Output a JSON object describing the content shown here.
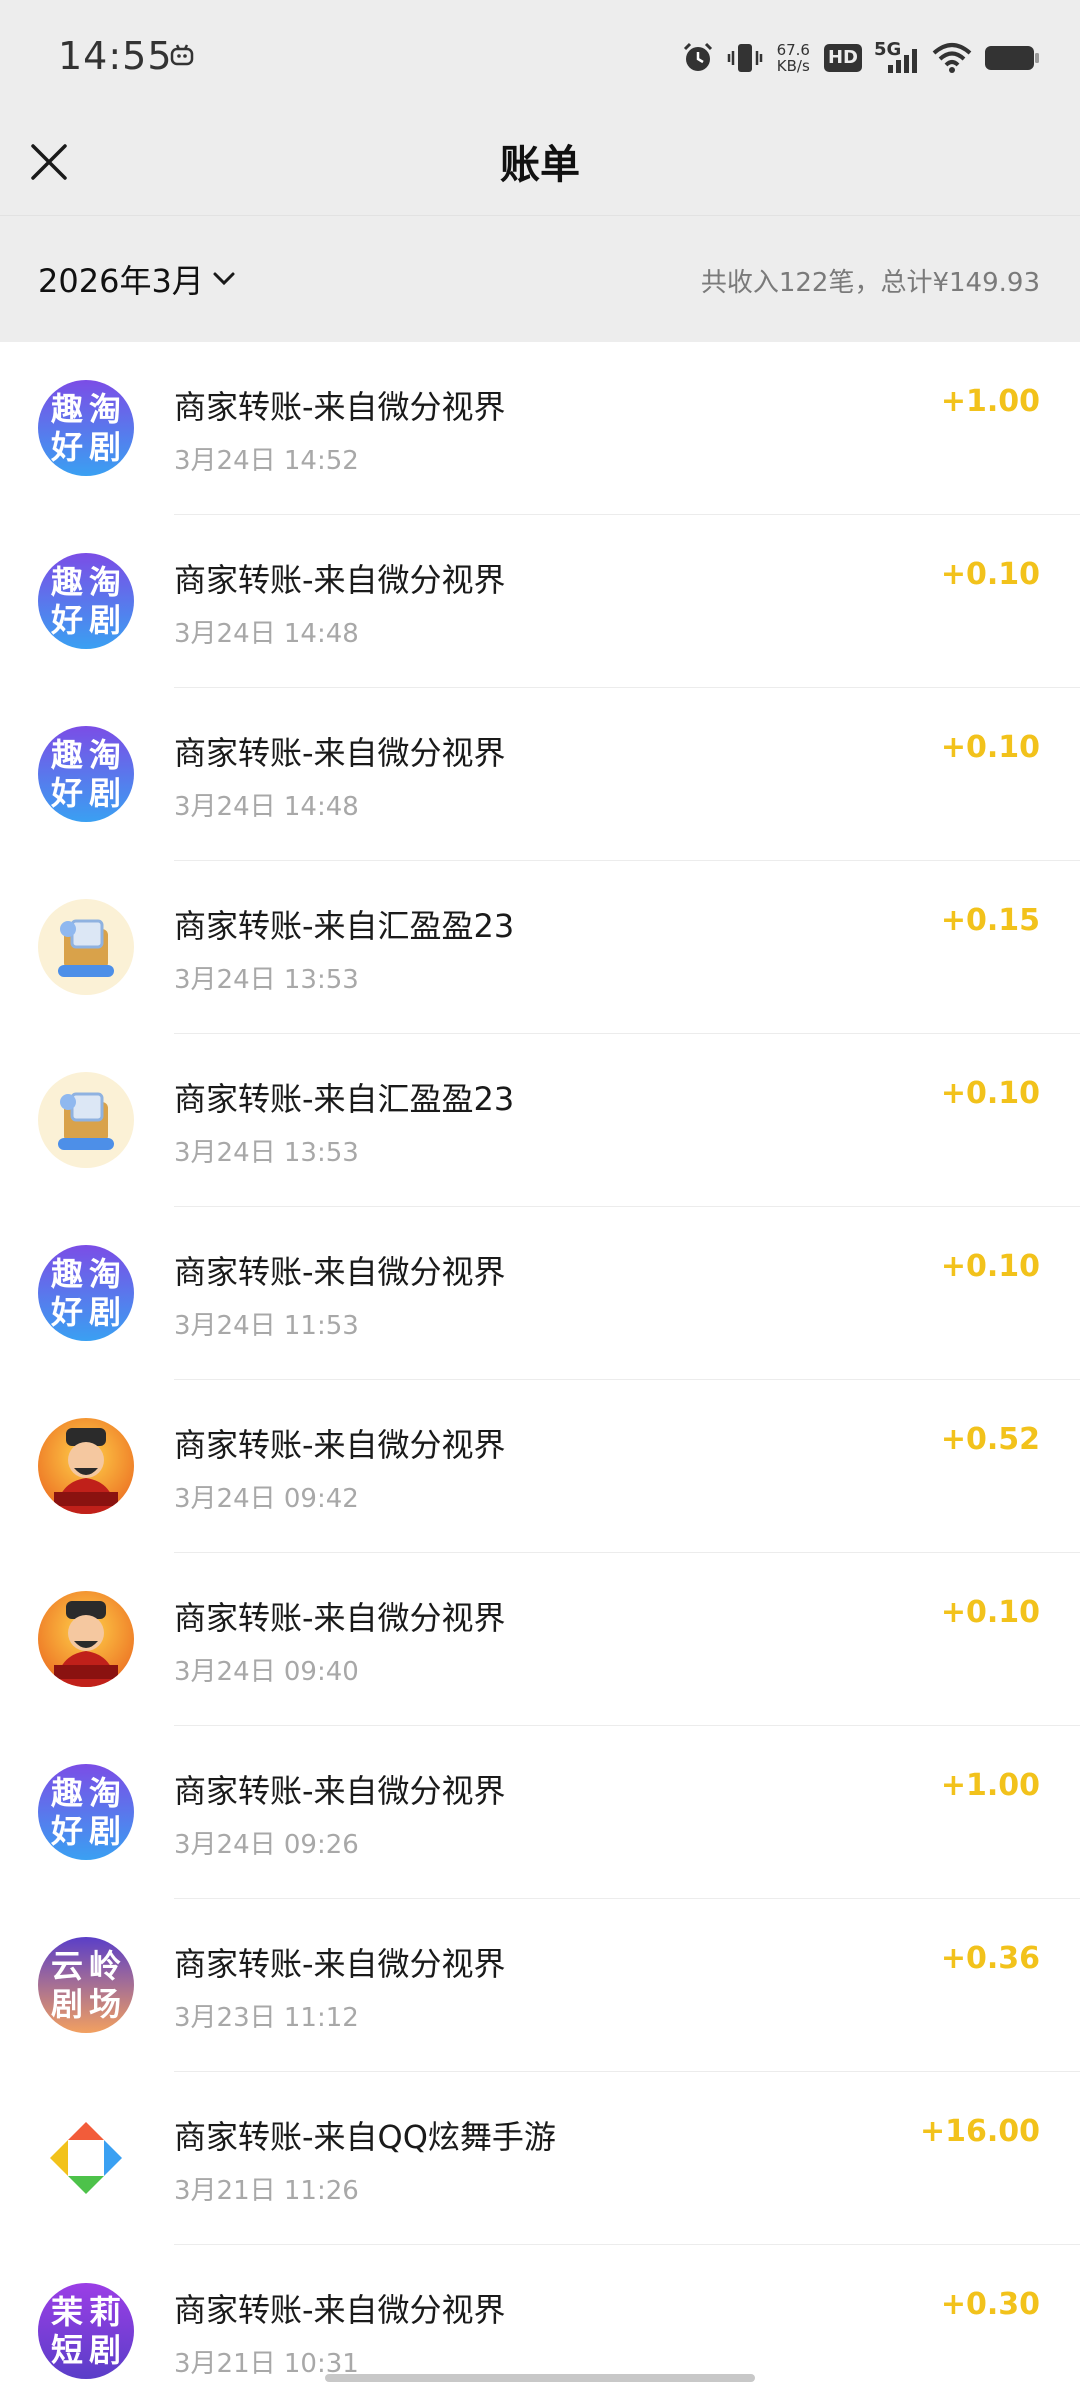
{
  "status": {
    "time": "14:55",
    "net_speed_value": "67.6",
    "net_speed_unit": "KB/s",
    "hd": "HD",
    "signal": "5G"
  },
  "header": {
    "title": "账单",
    "close_icon": "close-icon"
  },
  "filter": {
    "month": "2026年3月",
    "summary": "共收入122笔，总计¥149.93"
  },
  "bills": [
    {
      "title": "商家转账-来自微分视界",
      "time": "3月24日 14:52",
      "amount": "+1.00",
      "avatar": {
        "kind": "text",
        "chars": [
          "趣",
          "淘",
          "好",
          "剧"
        ],
        "colors": [
          "#7b4de6",
          "#3aa0f2"
        ]
      }
    },
    {
      "title": "商家转账-来自微分视界",
      "time": "3月24日 14:48",
      "amount": "+0.10",
      "avatar": {
        "kind": "text",
        "chars": [
          "趣",
          "淘",
          "好",
          "剧"
        ],
        "colors": [
          "#7b4de6",
          "#3aa0f2"
        ]
      }
    },
    {
      "title": "商家转账-来自微分视界",
      "time": "3月24日 14:48",
      "amount": "+0.10",
      "avatar": {
        "kind": "text",
        "chars": [
          "趣",
          "淘",
          "好",
          "剧"
        ],
        "colors": [
          "#7b4de6",
          "#3aa0f2"
        ]
      }
    },
    {
      "title": "商家转账-来自汇盈盈23",
      "time": "3月24日 13:53",
      "amount": "+0.15",
      "avatar": {
        "kind": "box"
      }
    },
    {
      "title": "商家转账-来自汇盈盈23",
      "time": "3月24日 13:53",
      "amount": "+0.10",
      "avatar": {
        "kind": "box"
      }
    },
    {
      "title": "商家转账-来自微分视界",
      "time": "3月24日 11:53",
      "amount": "+0.10",
      "avatar": {
        "kind": "text",
        "chars": [
          "趣",
          "淘",
          "好",
          "剧"
        ],
        "colors": [
          "#7b4de6",
          "#3aa0f2"
        ]
      }
    },
    {
      "title": "商家转账-来自微分视界",
      "time": "3月24日 09:42",
      "amount": "+0.52",
      "avatar": {
        "kind": "god"
      }
    },
    {
      "title": "商家转账-来自微分视界",
      "time": "3月24日 09:40",
      "amount": "+0.10",
      "avatar": {
        "kind": "god"
      }
    },
    {
      "title": "商家转账-来自微分视界",
      "time": "3月24日 09:26",
      "amount": "+1.00",
      "avatar": {
        "kind": "text",
        "chars": [
          "趣",
          "淘",
          "好",
          "剧"
        ],
        "colors": [
          "#7b4de6",
          "#3aa0f2"
        ]
      }
    },
    {
      "title": "商家转账-来自微分视界",
      "time": "3月23日 11:12",
      "amount": "+0.36",
      "avatar": {
        "kind": "text",
        "chars": [
          "云",
          "岭",
          "剧",
          "场"
        ],
        "colors": [
          "#5a3ec8",
          "#f2a060"
        ]
      }
    },
    {
      "title": "商家转账-来自QQ炫舞手游",
      "time": "3月21日 11:26",
      "amount": "+16.00",
      "avatar": {
        "kind": "qq"
      }
    },
    {
      "title": "商家转账-来自微分视界",
      "time": "3月21日 10:31",
      "amount": "+0.30",
      "avatar": {
        "kind": "text",
        "chars": [
          "茉",
          "莉",
          "短",
          "剧"
        ],
        "colors": [
          "#9b3ee6",
          "#5a3ec8"
        ]
      }
    }
  ],
  "colors": {
    "amount": "#f2c21b",
    "background_header": "#ededed"
  }
}
